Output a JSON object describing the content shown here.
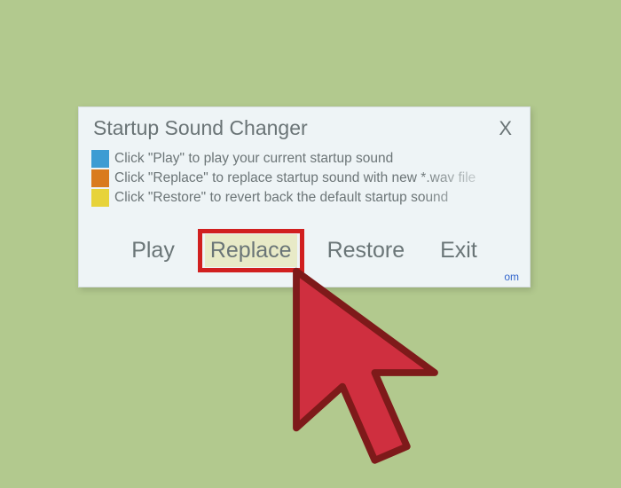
{
  "window": {
    "title": "Startup Sound Changer",
    "close_label": "X"
  },
  "info": [
    {
      "color": "#3d9cd3",
      "text": "Click \"Play\" to play your current startup sound"
    },
    {
      "color": "#d97b1d",
      "text": "Click \"Replace\" to replace startup sound with new *.wav file"
    },
    {
      "color": "#e7d33a",
      "text": "Click \"Restore\" to revert back the default startup sound"
    }
  ],
  "buttons": {
    "play": "Play",
    "replace": "Replace",
    "restore": "Restore",
    "exit": "Exit"
  },
  "link_fragment": "om"
}
